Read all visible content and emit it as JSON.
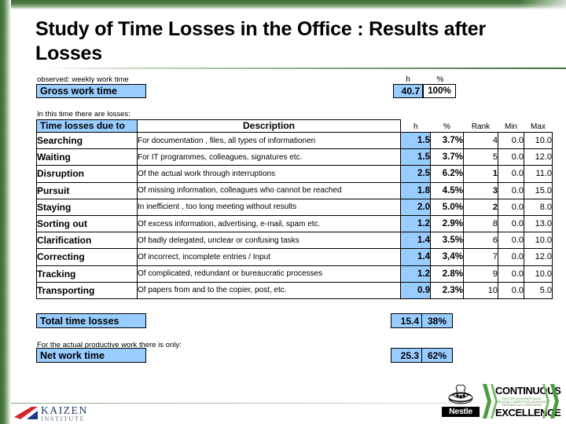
{
  "slide": {
    "title": "Study of Time Losses in the Office : Results after Losses"
  },
  "gross": {
    "caption": "observed: weekly work time",
    "label": "Gross work time",
    "head_h": "h",
    "head_pct": "%",
    "hours": "40.7",
    "percent": "100%"
  },
  "losses_caption": "In this time there are losses:",
  "table": {
    "headers": {
      "category": "Time losses due to",
      "description": "Description",
      "h": "h",
      "pct": "%",
      "rank": "Rank",
      "min": "Min",
      "max": "Max"
    },
    "rows": [
      {
        "category": "Searching",
        "description": "For documentation , files, all types of informationen",
        "h": "1.5",
        "pct": "3.7%",
        "rank": "4",
        "min": "0.0",
        "max": "10.0"
      },
      {
        "category": "Waiting",
        "description": "For IT programmes, colleagues, signatures etc.",
        "h": "1.5",
        "pct": "3.7%",
        "rank": "5",
        "min": "0.0",
        "max": "12.0"
      },
      {
        "category": "Disruption",
        "description": "Of the actual work through interruptions",
        "h": "2.5",
        "pct": "6.2%",
        "rank": "1",
        "min": "0.0",
        "max": "11.0"
      },
      {
        "category": "Pursuit",
        "description": "Of missing information, colleagues who cannot be reached",
        "h": "1.8",
        "pct": "4.5%",
        "rank": "3",
        "min": "0.0",
        "max": "15.0"
      },
      {
        "category": "Staying",
        "description": "In inefficient , too long meeting without results",
        "h": "2.0",
        "pct": "5.0%",
        "rank": "2",
        "min": "0.0",
        "max": "8.0"
      },
      {
        "category": "Sorting out",
        "description": "Of excess information, advertising, e-mail, spam etc.",
        "h": "1.2",
        "pct": "2.9%",
        "rank": "8",
        "min": "0.0",
        "max": "13.0"
      },
      {
        "category": "Clarification",
        "description": "Of badly delegated, unclear or confusing tasks",
        "h": "1.4",
        "pct": "3.5%",
        "rank": "6",
        "min": "0.0",
        "max": "10.0"
      },
      {
        "category": "Correcting",
        "description": "Of incorrect, incomplete entries / Input",
        "h": "1.4",
        "pct": "3,4%",
        "rank": "7",
        "min": "0.0",
        "max": "12.0"
      },
      {
        "category": "Tracking",
        "description": "Of complicated, redundant or bureaucratic processes",
        "h": "1.2",
        "pct": "2.8%",
        "rank": "9",
        "min": "0.0",
        "max": "10.0"
      },
      {
        "category": "Transporting",
        "description": "Of papers from and to the copier, post, etc.",
        "h": "0.9",
        "pct": "2.3%",
        "rank": "10",
        "min": "0.0",
        "max": "5.0"
      }
    ]
  },
  "total": {
    "label": "Total time losses",
    "hours": "15.4",
    "percent": "38%"
  },
  "net": {
    "caption": "For the actual productive work there is only:",
    "label": "Net work time",
    "hours": "25.3",
    "percent": "62%"
  },
  "footer": {
    "kaizen_name": "KAIZEN",
    "kaizen_sub": "INSTITUTE",
    "nestle_word": "Nestle",
    "ce_top": "CONTINUOUS",
    "ce_bottom": "EXCELLENCE",
    "ce_microtext": "DELIVER CONSUMER VALUE CREATING COMPETITIVE ADVANTAGE ENGAGING ALL COMPLIANCE"
  },
  "colors": {
    "accent_blue": "#99ccff",
    "frame_green": "#3f703a"
  }
}
